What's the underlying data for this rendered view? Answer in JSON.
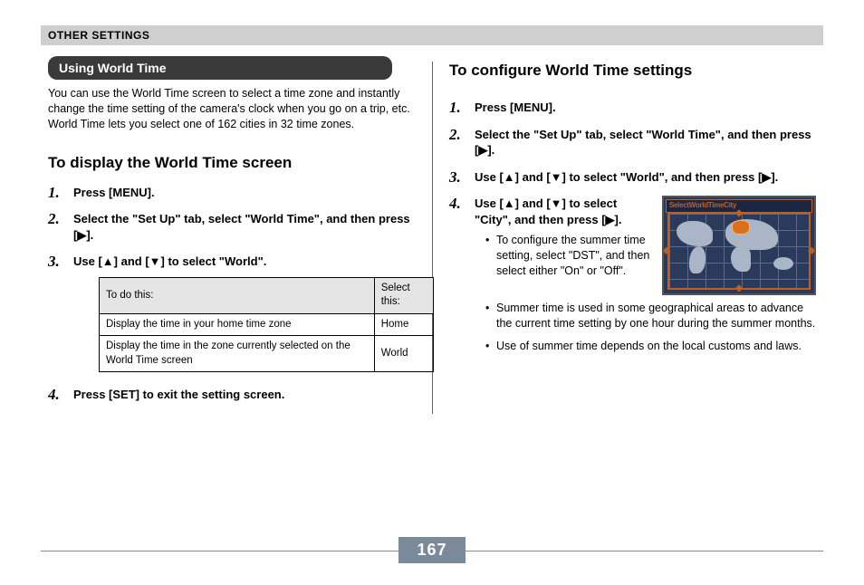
{
  "header": "OTHER SETTINGS",
  "left": {
    "pill": "Using World Time",
    "intro": "You can use the World Time screen to select a time zone and instantly change the time setting of the camera's clock when you go on a trip, etc. World Time lets you select one of 162 cities in 32 time zones.",
    "sub": "To display the World Time screen",
    "steps": {
      "s1": "Press [MENU].",
      "s2": "Select the \"Set Up\" tab, select \"World Time\", and then press [▶].",
      "s3": "Use [▲] and [▼] to select \"World\".",
      "s4": "Press [SET] to exit the setting screen."
    },
    "table": {
      "h1": "To do this:",
      "h2": "Select this:",
      "r1c1": "Display the time in your home time zone",
      "r1c2": "Home",
      "r2c1": "Display the time in the zone currently selected on the World Time screen",
      "r2c2": "World"
    }
  },
  "right": {
    "sub": "To configure World Time settings",
    "steps": {
      "s1": "Press [MENU].",
      "s2": "Select the \"Set Up\" tab, select \"World Time\", and then press [▶].",
      "s3": "Use [▲] and [▼] to select \"World\", and then press [▶].",
      "s4": "Use [▲] and [▼] to select \"City\", and then press [▶]."
    },
    "bullets": {
      "b1": "To configure the summer time setting, select \"DST\", and then select either \"On\" or \"Off\".",
      "b2": "Summer time is used in some geographical areas to advance the current time setting by one hour during the summer months.",
      "b3": "Use of summer time depends on the local customs and laws."
    },
    "map_title": "SelectWorldTimeCity"
  },
  "page_number": "167"
}
